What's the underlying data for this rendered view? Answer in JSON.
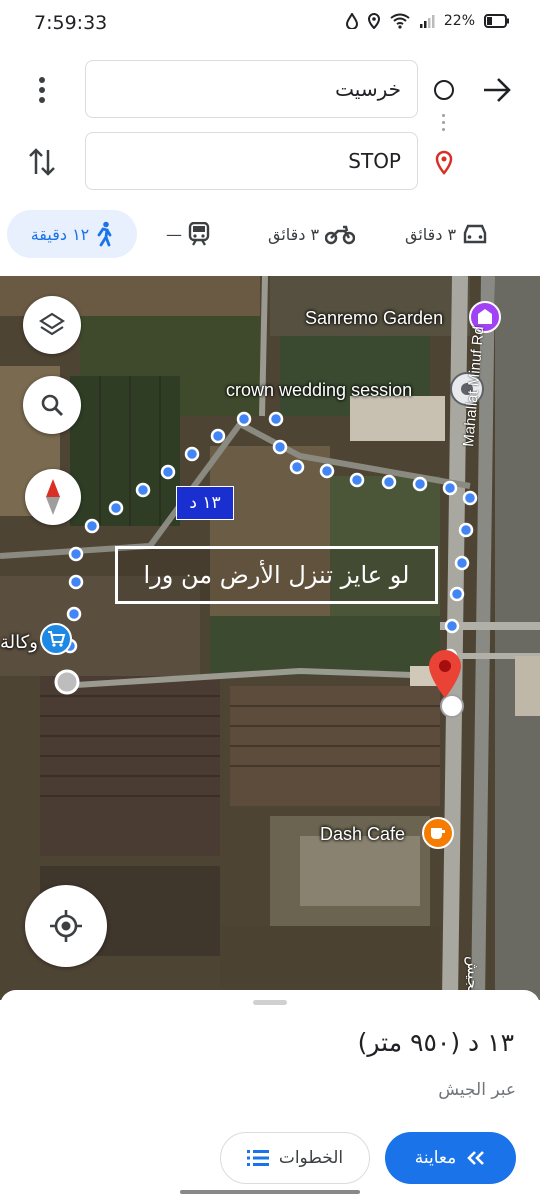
{
  "status": {
    "time": "7:59:33",
    "battery": "22%"
  },
  "route": {
    "origin": "خرسيت",
    "destination": "STOP"
  },
  "modes": {
    "walk": "١٢ دقيقة",
    "transit": "—",
    "motorcycle": "٣ دقائق",
    "car": "٣ دقائق"
  },
  "map": {
    "poi_sanremo": "Sanremo Garden",
    "poi_crown": "crown wedding session",
    "poi_wakala": "وكالة",
    "poi_dash": "Dash Cafe",
    "road_mahallat": "Mahallat Minuf Rd",
    "road_arabic": "أم الزايد الجيش",
    "route_badge": "١٣ د",
    "overlay_text": "لو عايز تنزل الأرض من ورا",
    "accent": "#1a73e8"
  },
  "sheet": {
    "duration": "١٣ د (٩٥٠ متر)",
    "via": "عبر الجيش",
    "preview_label": "معاينة",
    "steps_label": "الخطوات"
  }
}
